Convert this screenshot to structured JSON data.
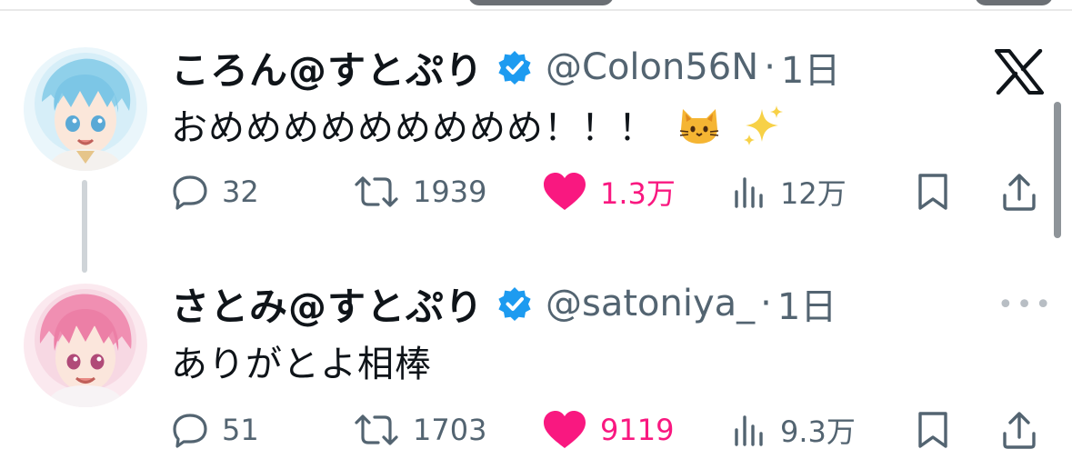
{
  "tweets": [
    {
      "name": "ころん@すとぷり",
      "handle": "@Colon56N",
      "separator": "·",
      "time": "1日",
      "text": "おめめめめめめめめめ！！！",
      "emojis": [
        "cat-face-emoji",
        "sparkles-emoji"
      ],
      "replies": "32",
      "retweets": "1939",
      "likes": "1.3万",
      "views": "12万"
    },
    {
      "name": "さとみ@すとぷり",
      "handle": "@satoniya_",
      "separator": "·",
      "time": "1日",
      "text": "ありがとよ相棒",
      "replies": "51",
      "retweets": "1703",
      "likes": "9119",
      "views": "9.3万"
    }
  ],
  "more_label": "•••",
  "colors": {
    "verified": "#1d9bf0",
    "like": "#f91880",
    "muted": "#536471",
    "text": "#0f1419"
  },
  "icons": [
    "reply-icon",
    "retweet-icon",
    "like-heart-icon",
    "views-icon",
    "bookmark-icon",
    "share-icon",
    "x-logo-icon",
    "verified-badge-icon"
  ]
}
